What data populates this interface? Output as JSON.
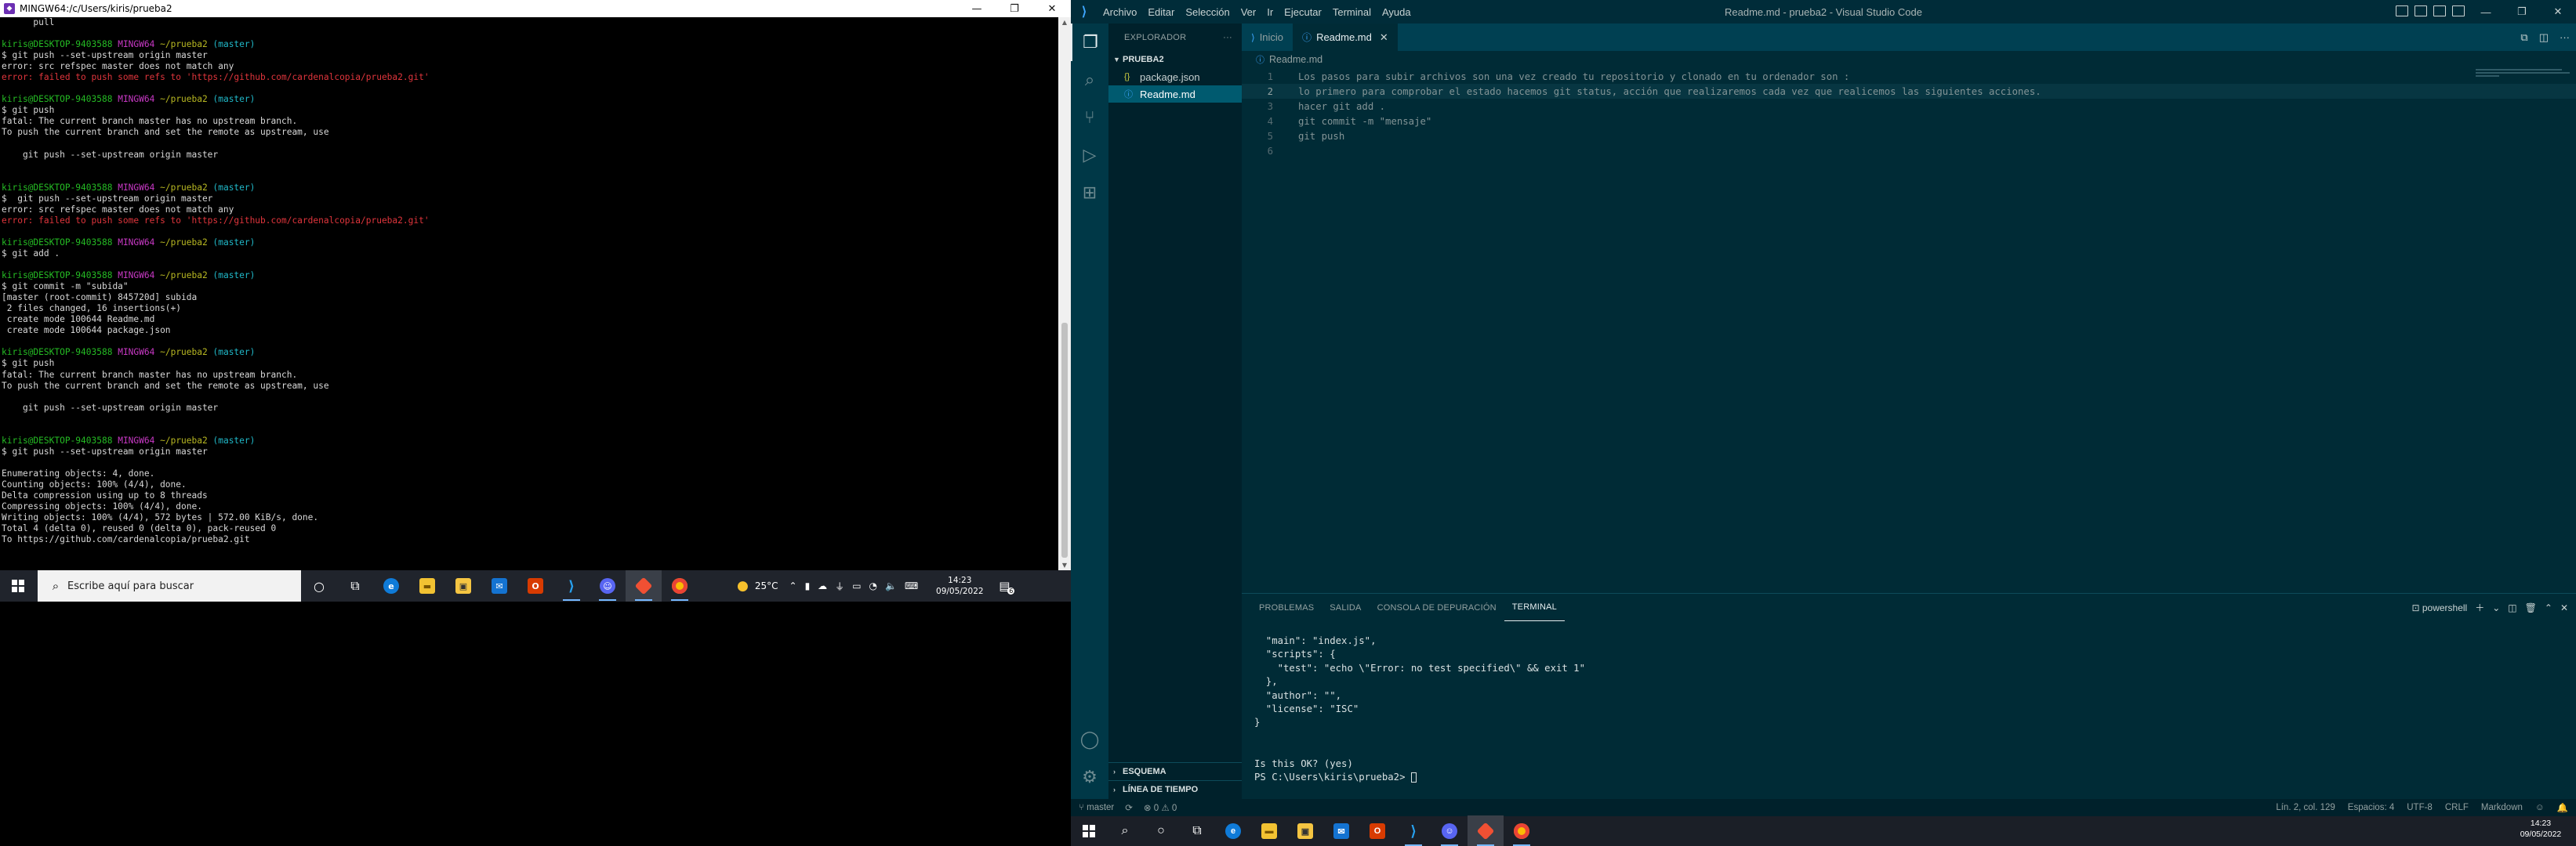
{
  "terminal": {
    "title": "MINGW64:/c/Users/kiris/prueba2",
    "lines": [
      {
        "t": "      pull",
        "c": ""
      },
      {
        "t": "",
        "c": ""
      },
      {
        "t": "kiris@DESKTOP-9403588 MINGW64 ~/prueba2 (master)",
        "c": "prompt"
      },
      {
        "t": "$ git push --set-upstream origin master",
        "c": ""
      },
      {
        "t": "error: src refspec master does not match any",
        "c": ""
      },
      {
        "t": "error: failed to push some refs to 'https://github.com/cardenalcopia/prueba2.git'",
        "c": "r"
      },
      {
        "t": "",
        "c": ""
      },
      {
        "t": "kiris@DESKTOP-9403588 MINGW64 ~/prueba2 (master)",
        "c": "prompt"
      },
      {
        "t": "$ git push",
        "c": ""
      },
      {
        "t": "fatal: The current branch master has no upstream branch.",
        "c": ""
      },
      {
        "t": "To push the current branch and set the remote as upstream, use",
        "c": ""
      },
      {
        "t": "",
        "c": ""
      },
      {
        "t": "    git push --set-upstream origin master",
        "c": ""
      },
      {
        "t": "",
        "c": ""
      },
      {
        "t": "",
        "c": ""
      },
      {
        "t": "kiris@DESKTOP-9403588 MINGW64 ~/prueba2 (master)",
        "c": "prompt"
      },
      {
        "t": "$  git push --set-upstream origin master",
        "c": ""
      },
      {
        "t": "error: src refspec master does not match any",
        "c": ""
      },
      {
        "t": "error: failed to push some refs to 'https://github.com/cardenalcopia/prueba2.git'",
        "c": "r"
      },
      {
        "t": "",
        "c": ""
      },
      {
        "t": "kiris@DESKTOP-9403588 MINGW64 ~/prueba2 (master)",
        "c": "prompt"
      },
      {
        "t": "$ git add .",
        "c": ""
      },
      {
        "t": "",
        "c": ""
      },
      {
        "t": "kiris@DESKTOP-9403588 MINGW64 ~/prueba2 (master)",
        "c": "prompt"
      },
      {
        "t": "$ git commit -m \"subida\"",
        "c": ""
      },
      {
        "t": "[master (root-commit) 845720d] subida",
        "c": ""
      },
      {
        "t": " 2 files changed, 16 insertions(+)",
        "c": ""
      },
      {
        "t": " create mode 100644 Readme.md",
        "c": ""
      },
      {
        "t": " create mode 100644 package.json",
        "c": ""
      },
      {
        "t": "",
        "c": ""
      },
      {
        "t": "kiris@DESKTOP-9403588 MINGW64 ~/prueba2 (master)",
        "c": "prompt"
      },
      {
        "t": "$ git push",
        "c": ""
      },
      {
        "t": "fatal: The current branch master has no upstream branch.",
        "c": ""
      },
      {
        "t": "To push the current branch and set the remote as upstream, use",
        "c": ""
      },
      {
        "t": "",
        "c": ""
      },
      {
        "t": "    git push --set-upstream origin master",
        "c": ""
      },
      {
        "t": "",
        "c": ""
      },
      {
        "t": "",
        "c": ""
      },
      {
        "t": "kiris@DESKTOP-9403588 MINGW64 ~/prueba2 (master)",
        "c": "prompt"
      },
      {
        "t": "$ git push --set-upstream origin master",
        "c": ""
      },
      {
        "t": "",
        "c": ""
      },
      {
        "t": "Enumerating objects: 4, done.",
        "c": ""
      },
      {
        "t": "Counting objects: 100% (4/4), done.",
        "c": ""
      },
      {
        "t": "Delta compression using up to 8 threads",
        "c": ""
      },
      {
        "t": "Compressing objects: 100% (4/4), done.",
        "c": ""
      },
      {
        "t": "Writing objects: 100% (4/4), 572 bytes | 572.00 KiB/s, done.",
        "c": ""
      },
      {
        "t": "Total 4 (delta 0), reused 0 (delta 0), pack-reused 0",
        "c": ""
      },
      {
        "t": "To https://github.com/cardenalcopia/prueba2.git",
        "c": ""
      }
    ]
  },
  "taskbar_left": {
    "search_placeholder": "Escribe aquí para buscar",
    "weather": "25°C",
    "time": "14:23",
    "date": "09/05/2022",
    "notification_count": "6"
  },
  "vscode": {
    "window_title": "Readme.md - prueba2 - Visual Studio Code",
    "menu": [
      "Archivo",
      "Editar",
      "Selección",
      "Ver",
      "Ir",
      "Ejecutar",
      "Terminal",
      "Ayuda"
    ],
    "explorer_title": "EXPLORADOR",
    "folder_name": "PRUEBA2",
    "files": [
      {
        "name": "package.json",
        "icon": "{}"
      },
      {
        "name": "Readme.md",
        "icon": "ⓘ"
      }
    ],
    "outline_label": "ESQUEMA",
    "timeline_label": "LÍNEA DE TIEMPO",
    "tabs": [
      {
        "label": "Inicio",
        "icon": "vscode-icon"
      },
      {
        "label": "Readme.md",
        "icon": "info-icon"
      }
    ],
    "breadcrumb": "Readme.md",
    "code_lines": [
      {
        "n": "1",
        "text": "Los pasos para subir archivos son una vez creado tu repositorio y clonado en tu ordenador son :"
      },
      {
        "n": "2",
        "text": "lo primero para comprobar el estado hacemos git status, acción que realizaremos cada vez que realicemos las siguientes acciones."
      },
      {
        "n": "3",
        "text": "hacer git add ."
      },
      {
        "n": "4",
        "text": "git commit -m \"mensaje\""
      },
      {
        "n": "5",
        "text": "git push"
      },
      {
        "n": "6",
        "text": ""
      }
    ],
    "panel_tabs": [
      "PROBLEMAS",
      "SALIDA",
      "CONSOLA DE DEPURACIÓN",
      "TERMINAL"
    ],
    "panel_shell": "powershell",
    "panel_lines": [
      "  \"main\": \"index.js\",",
      "  \"scripts\": {",
      "    \"test\": \"echo \\\"Error: no test specified\\\" && exit 1\"",
      "  },",
      "  \"author\": \"\",",
      "  \"license\": \"ISC\"",
      "}",
      "",
      "",
      "Is this OK? (yes)"
    ],
    "panel_prompt": "PS C:\\Users\\kiris\\prueba2> ",
    "status": {
      "branch": "master",
      "errors": "0",
      "warnings": "0",
      "cursor": "Lín. 2, col. 129",
      "spaces": "Espacios: 4",
      "encoding": "UTF-8",
      "eol": "CRLF",
      "language": "Markdown"
    }
  },
  "taskbar_right": {
    "time": "14:23",
    "date": "09/05/2022"
  },
  "colors": {
    "prompt_green": "#25bc24",
    "prompt_magenta": "#c839c5",
    "prompt_yellow": "#b8b822",
    "error_red": "#e0353c",
    "vscode_bg": "#002b36"
  }
}
